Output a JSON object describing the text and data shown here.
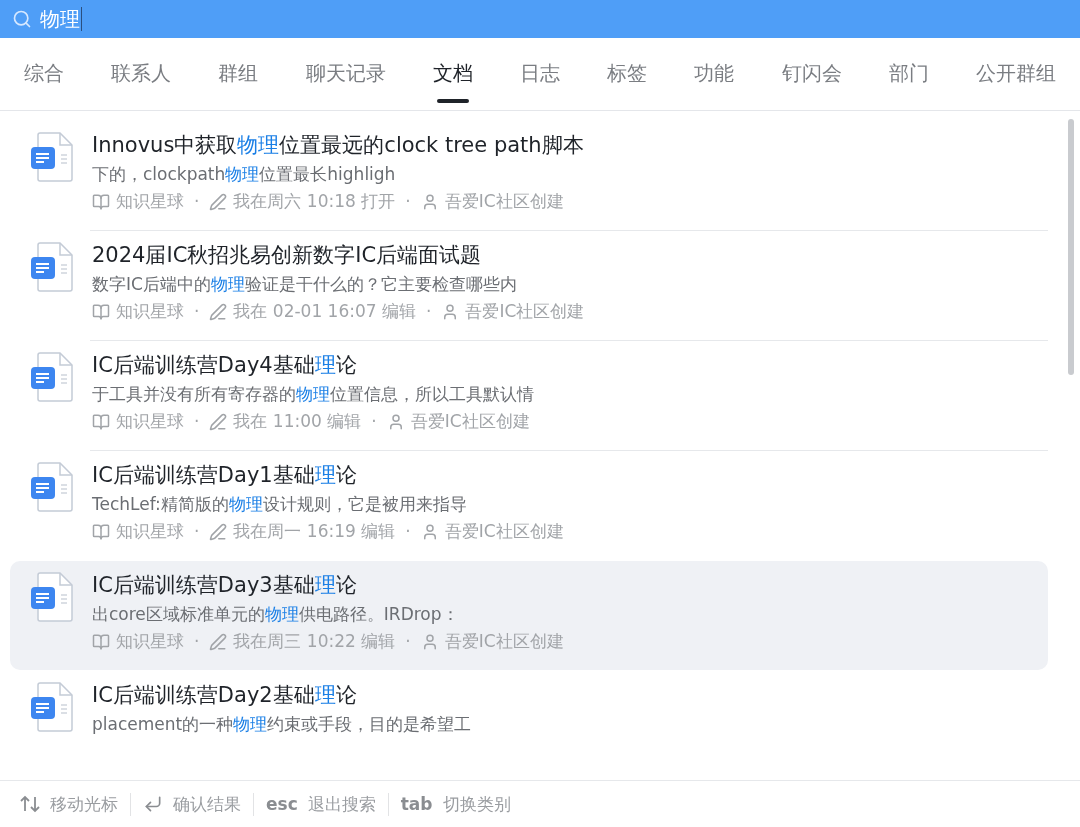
{
  "search": {
    "value": "物理"
  },
  "tabs": [
    {
      "label": "综合",
      "selected": false
    },
    {
      "label": "联系人",
      "selected": false
    },
    {
      "label": "群组",
      "selected": false
    },
    {
      "label": "聊天记录",
      "selected": false
    },
    {
      "label": "文档",
      "selected": true
    },
    {
      "label": "日志",
      "selected": false
    },
    {
      "label": "标签",
      "selected": false
    },
    {
      "label": "功能",
      "selected": false
    },
    {
      "label": "钉闪会",
      "selected": false
    },
    {
      "label": "部门",
      "selected": false
    },
    {
      "label": "公开群组",
      "selected": false
    }
  ],
  "results": [
    {
      "selected": false,
      "title": [
        {
          "text": "Innovus中获取",
          "match": false
        },
        {
          "text": "物理",
          "match": true
        },
        {
          "text": "位置最远的clock tree path脚本",
          "match": false
        }
      ],
      "snippet": [
        {
          "text": "下的，clockpath",
          "match": false
        },
        {
          "text": "物理",
          "match": true
        },
        {
          "text": "位置最长highligh",
          "match": false
        }
      ],
      "meta": [
        {
          "kind": "source",
          "text": "知识星球"
        },
        {
          "kind": "separator",
          "text": "·"
        },
        {
          "kind": "activity",
          "text": "我在周六 10:18 打开"
        },
        {
          "kind": "separator",
          "text": "·"
        },
        {
          "kind": "creator",
          "text": "吾爱IC社区创建"
        }
      ]
    },
    {
      "selected": false,
      "title": [
        {
          "text": "2024届IC秋招兆易创新数字IC后端面试题",
          "match": false
        }
      ],
      "snippet": [
        {
          "text": "数字IC后端中的",
          "match": false
        },
        {
          "text": "物理",
          "match": true
        },
        {
          "text": "验证是干什么的？它主要检查哪些内",
          "match": false
        }
      ],
      "meta": [
        {
          "kind": "source",
          "text": "知识星球"
        },
        {
          "kind": "separator",
          "text": "·"
        },
        {
          "kind": "activity",
          "text": "我在 02-01 16:07 编辑"
        },
        {
          "kind": "separator",
          "text": "·"
        },
        {
          "kind": "creator",
          "text": "吾爱IC社区创建"
        }
      ]
    },
    {
      "selected": false,
      "title": [
        {
          "text": "IC后端训练营Day4基础",
          "match": false
        },
        {
          "text": "理",
          "match": true
        },
        {
          "text": "论",
          "match": false
        }
      ],
      "snippet": [
        {
          "text": "于工具并没有所有寄存器的",
          "match": false
        },
        {
          "text": "物理",
          "match": true
        },
        {
          "text": "位置信息，所以工具默认情",
          "match": false
        }
      ],
      "meta": [
        {
          "kind": "source",
          "text": "知识星球"
        },
        {
          "kind": "separator",
          "text": "·"
        },
        {
          "kind": "activity",
          "text": "我在 11:00 编辑"
        },
        {
          "kind": "separator",
          "text": "·"
        },
        {
          "kind": "creator",
          "text": "吾爱IC社区创建"
        }
      ]
    },
    {
      "selected": false,
      "title": [
        {
          "text": "IC后端训练营Day1基础",
          "match": false
        },
        {
          "text": "理",
          "match": true
        },
        {
          "text": "论",
          "match": false
        }
      ],
      "snippet": [
        {
          "text": "TechLef:精简版的",
          "match": false
        },
        {
          "text": "物理",
          "match": true
        },
        {
          "text": "设计规则，它是被用来指导",
          "match": false
        }
      ],
      "meta": [
        {
          "kind": "source",
          "text": "知识星球"
        },
        {
          "kind": "separator",
          "text": "·"
        },
        {
          "kind": "activity",
          "text": "我在周一 16:19 编辑"
        },
        {
          "kind": "separator",
          "text": "·"
        },
        {
          "kind": "creator",
          "text": "吾爱IC社区创建"
        }
      ]
    },
    {
      "selected": true,
      "title": [
        {
          "text": "IC后端训练营Day3基础",
          "match": false
        },
        {
          "text": "理",
          "match": true
        },
        {
          "text": "论",
          "match": false
        }
      ],
      "snippet": [
        {
          "text": "出core区域标准单元的",
          "match": false
        },
        {
          "text": "物理",
          "match": true
        },
        {
          "text": "供电路径。IRDrop：",
          "match": false
        }
      ],
      "meta": [
        {
          "kind": "source",
          "text": "知识星球"
        },
        {
          "kind": "separator",
          "text": "·"
        },
        {
          "kind": "activity",
          "text": "我在周三 10:22 编辑"
        },
        {
          "kind": "separator",
          "text": "·"
        },
        {
          "kind": "creator",
          "text": "吾爱IC社区创建"
        }
      ]
    },
    {
      "selected": false,
      "title": [
        {
          "text": "IC后端训练营Day2基础",
          "match": false
        },
        {
          "text": "理",
          "match": true
        },
        {
          "text": "论",
          "match": false
        }
      ],
      "snippet": [
        {
          "text": "placement的一种",
          "match": false
        },
        {
          "text": "物理",
          "match": true
        },
        {
          "text": "约束或手段，目的是希望工",
          "match": false
        }
      ]
    }
  ],
  "footer": [
    {
      "kind": "arrows",
      "label": "移动光标"
    },
    {
      "kind": "enter",
      "label": "确认结果"
    },
    {
      "kind": "key",
      "key": "esc",
      "label": "退出搜索"
    },
    {
      "kind": "key",
      "key": "tab",
      "label": "切换类别"
    }
  ]
}
